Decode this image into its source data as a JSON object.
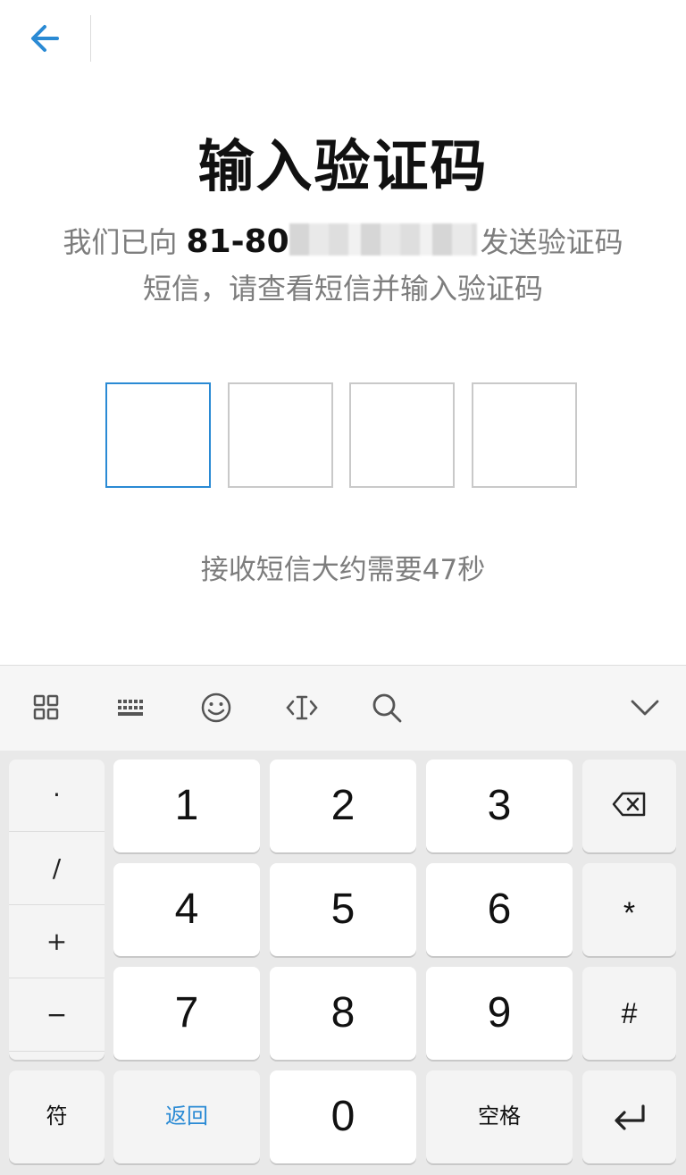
{
  "header": {
    "back_icon": "arrow-left-icon",
    "accent": "#2a8ad4"
  },
  "title": "输入验证码",
  "subtitle": {
    "prefix": "我们已向",
    "phone_visible": "81-80",
    "suffix": "发送验证码",
    "line2": "短信，请查看短信并输入验证码"
  },
  "code_boxes": [
    "",
    "",
    "",
    ""
  ],
  "timer_text": "接收短信大约需要47秒",
  "keyboard": {
    "toolbar_icons": [
      "grid-icon",
      "keyboard-icon",
      "emoji-icon",
      "cursor-icon",
      "search-icon",
      "chevron-down-icon"
    ],
    "side_keys": [
      "·",
      "/",
      "+",
      "−"
    ],
    "digits": [
      "1",
      "2",
      "3",
      "4",
      "5",
      "6",
      "7",
      "8",
      "9",
      "0"
    ],
    "star": "*",
    "hash": "#",
    "symbol_label": "符",
    "back_label": "返回",
    "space_label": "空格",
    "icons": {
      "delete": "backspace-icon",
      "enter": "enter-icon"
    }
  }
}
